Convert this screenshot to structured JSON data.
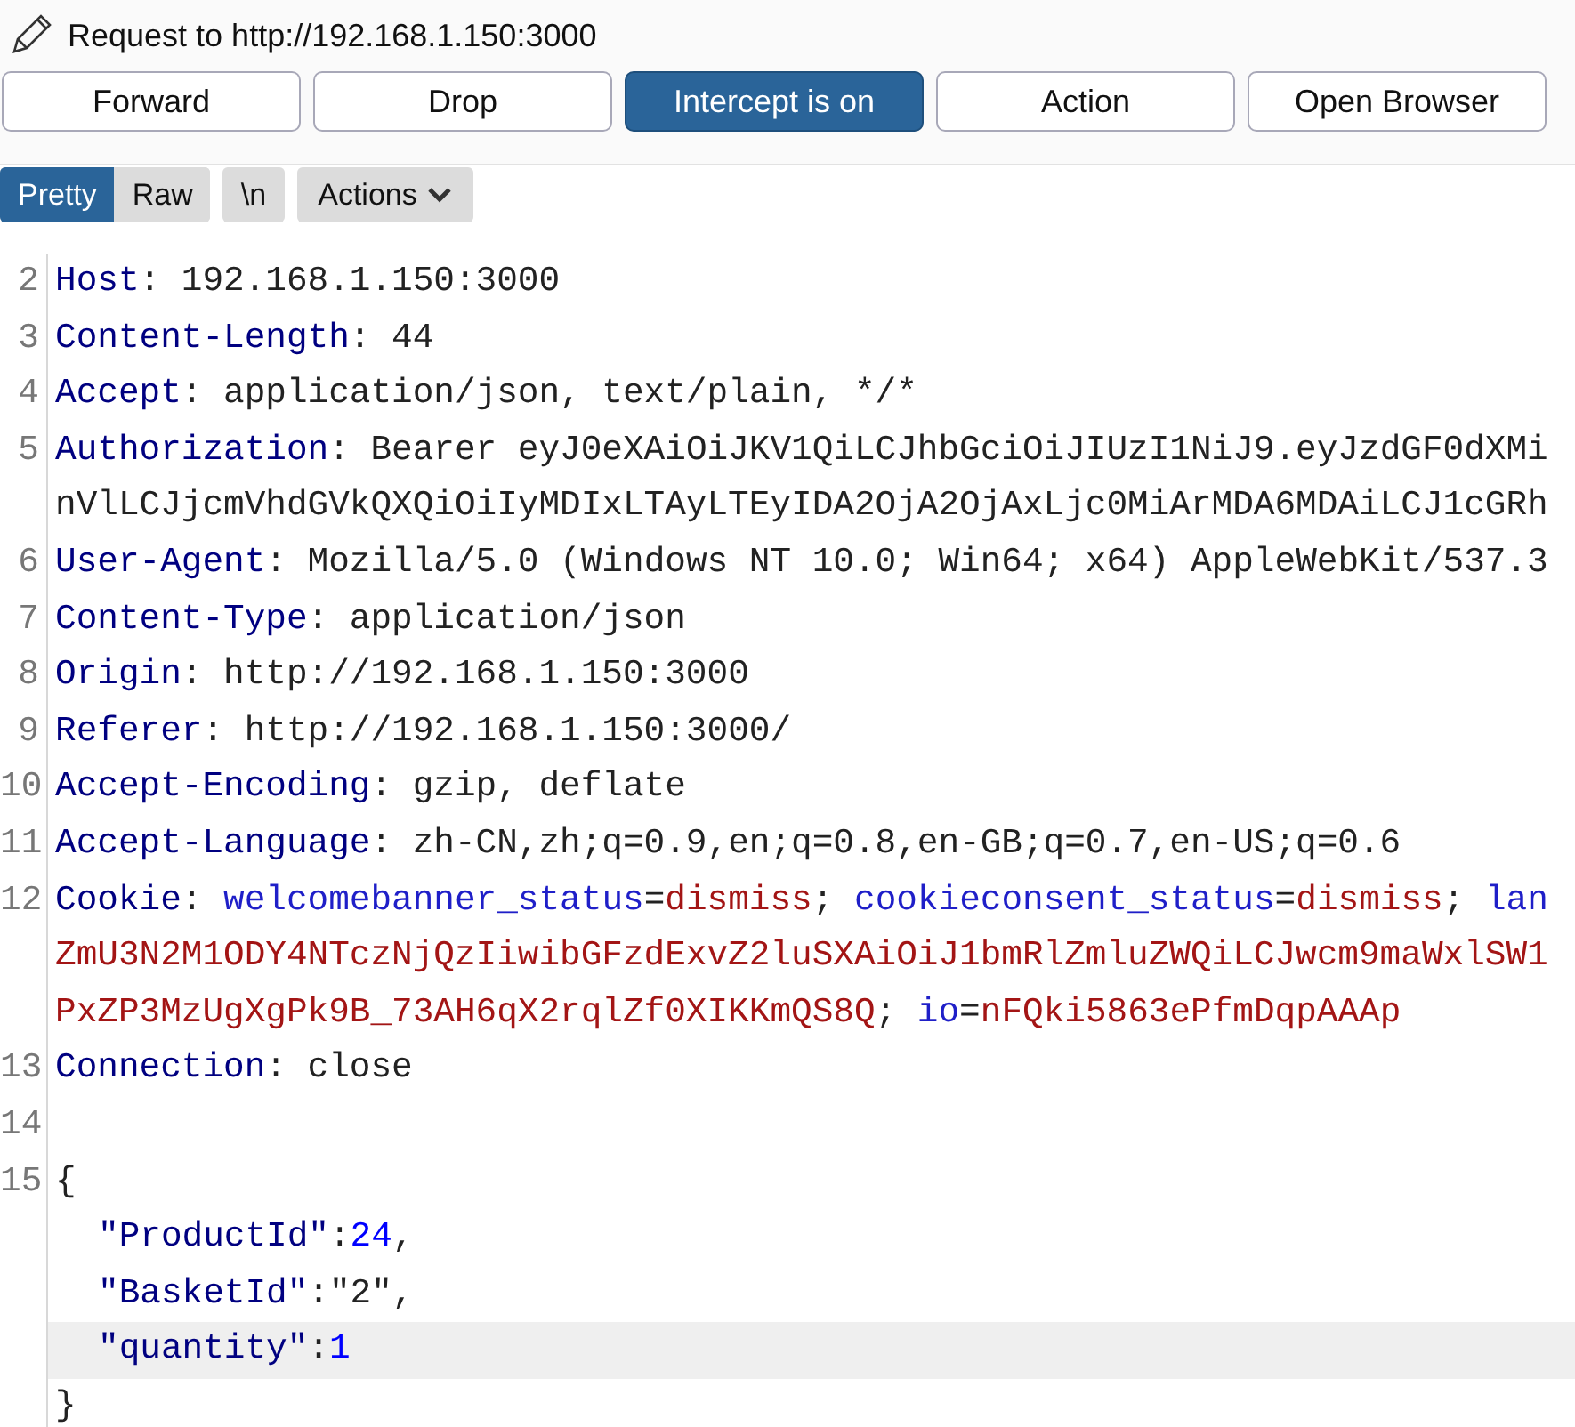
{
  "title": "Request to http://192.168.1.150:3000",
  "buttons": [
    {
      "label": "Forward",
      "selected": false
    },
    {
      "label": "Drop",
      "selected": false
    },
    {
      "label": "Intercept is on",
      "selected": true
    },
    {
      "label": "Action",
      "selected": false
    },
    {
      "label": "Open Browser",
      "selected": false
    }
  ],
  "view_tabs": [
    {
      "label": "Pretty",
      "selected": true
    },
    {
      "label": "Raw",
      "selected": false
    }
  ],
  "newline_toggle": {
    "label": "\\n"
  },
  "actions_menu": {
    "label": "Actions"
  },
  "editor": {
    "lines": [
      {
        "number": "2",
        "rows": [
          {
            "highlighted": false,
            "segments": [
              {
                "kind": "key",
                "text": "Host"
              },
              {
                "kind": "plain",
                "text": ": 192.168.1.150:3000"
              }
            ]
          }
        ]
      },
      {
        "number": "3",
        "rows": [
          {
            "highlighted": false,
            "segments": [
              {
                "kind": "key",
                "text": "Content-Length"
              },
              {
                "kind": "plain",
                "text": ": 44"
              }
            ]
          }
        ]
      },
      {
        "number": "4",
        "rows": [
          {
            "highlighted": false,
            "segments": [
              {
                "kind": "key",
                "text": "Accept"
              },
              {
                "kind": "plain",
                "text": ": application/json, text/plain, */*"
              }
            ]
          }
        ]
      },
      {
        "number": "5",
        "rows": [
          {
            "highlighted": false,
            "segments": [
              {
                "kind": "key",
                "text": "Authorization"
              },
              {
                "kind": "plain",
                "text": ": Bearer eyJ0eXAiOiJKV1QiLCJhbGciOiJIUzI1NiJ9.eyJzdGF0dXMi"
              }
            ]
          },
          {
            "highlighted": false,
            "segments": [
              {
                "kind": "plain",
                "text": "nVlLCJjcmVhdGVkQXQiOiIyMDIxLTAyLTEyIDA2OjA2OjAxLjc0MiArMDA6MDAiLCJ1cGRh"
              }
            ]
          }
        ]
      },
      {
        "number": "6",
        "rows": [
          {
            "highlighted": false,
            "segments": [
              {
                "kind": "key",
                "text": "User-Agent"
              },
              {
                "kind": "plain",
                "text": ": Mozilla/5.0 (Windows NT 10.0; Win64; x64) AppleWebKit/537.3"
              }
            ]
          }
        ]
      },
      {
        "number": "7",
        "rows": [
          {
            "highlighted": false,
            "segments": [
              {
                "kind": "key",
                "text": "Content-Type"
              },
              {
                "kind": "plain",
                "text": ": application/json"
              }
            ]
          }
        ]
      },
      {
        "number": "8",
        "rows": [
          {
            "highlighted": false,
            "segments": [
              {
                "kind": "key",
                "text": "Origin"
              },
              {
                "kind": "plain",
                "text": ": http://192.168.1.150:3000"
              }
            ]
          }
        ]
      },
      {
        "number": "9",
        "rows": [
          {
            "highlighted": false,
            "segments": [
              {
                "kind": "key",
                "text": "Referer"
              },
              {
                "kind": "plain",
                "text": ": http://192.168.1.150:3000/"
              }
            ]
          }
        ]
      },
      {
        "number": "10",
        "rows": [
          {
            "highlighted": false,
            "segments": [
              {
                "kind": "key",
                "text": "Accept-Encoding"
              },
              {
                "kind": "plain",
                "text": ": gzip, deflate"
              }
            ]
          }
        ]
      },
      {
        "number": "11",
        "rows": [
          {
            "highlighted": false,
            "segments": [
              {
                "kind": "key",
                "text": "Accept-Language"
              },
              {
                "kind": "plain",
                "text": ": zh-CN,zh;q=0.9,en;q=0.8,en-GB;q=0.7,en-US;q=0.6"
              }
            ]
          }
        ]
      },
      {
        "number": "12",
        "rows": [
          {
            "highlighted": false,
            "segments": [
              {
                "kind": "key",
                "text": "Cookie"
              },
              {
                "kind": "plain",
                "text": ": "
              },
              {
                "kind": "cookie_name",
                "text": "welcomebanner_status"
              },
              {
                "kind": "plain",
                "text": "="
              },
              {
                "kind": "cookie_value",
                "text": "dismiss"
              },
              {
                "kind": "plain",
                "text": "; "
              },
              {
                "kind": "cookie_name",
                "text": "cookieconsent_status"
              },
              {
                "kind": "plain",
                "text": "="
              },
              {
                "kind": "cookie_value",
                "text": "dismiss"
              },
              {
                "kind": "plain",
                "text": "; "
              },
              {
                "kind": "cookie_name",
                "text": "lan"
              }
            ]
          },
          {
            "highlighted": false,
            "segments": [
              {
                "kind": "cookie_value",
                "text": "ZmU3N2M1ODY4NTczNjQzIiwibGFzdExvZ2luSXAiOiJ1bmRlZmluZWQiLCJwcm9maWxlSW1"
              }
            ]
          },
          {
            "highlighted": false,
            "segments": [
              {
                "kind": "cookie_value",
                "text": "PxZP3MzUgXgPk9B_73AH6qX2rqlZf0XIKKmQS8Q"
              },
              {
                "kind": "plain",
                "text": "; "
              },
              {
                "kind": "cookie_name",
                "text": "io"
              },
              {
                "kind": "plain",
                "text": "="
              },
              {
                "kind": "cookie_value",
                "text": "nFQki5863ePfmDqpAAAp"
              }
            ]
          }
        ]
      },
      {
        "number": "13",
        "rows": [
          {
            "highlighted": false,
            "segments": [
              {
                "kind": "key",
                "text": "Connection"
              },
              {
                "kind": "plain",
                "text": ": close"
              }
            ]
          }
        ]
      },
      {
        "number": "14",
        "rows": [
          {
            "highlighted": false,
            "segments": []
          }
        ]
      },
      {
        "number": "15",
        "rows": [
          {
            "highlighted": false,
            "segments": [
              {
                "kind": "plain",
                "text": "{"
              }
            ]
          },
          {
            "highlighted": false,
            "indented": true,
            "segments": [
              {
                "kind": "key",
                "text": "\"ProductId\""
              },
              {
                "kind": "plain",
                "text": ":"
              },
              {
                "kind": "number",
                "text": "24"
              },
              {
                "kind": "plain",
                "text": ","
              }
            ]
          },
          {
            "highlighted": false,
            "indented": true,
            "segments": [
              {
                "kind": "key",
                "text": "\"BasketId\""
              },
              {
                "kind": "plain",
                "text": ":\"2\","
              }
            ]
          },
          {
            "highlighted": true,
            "indented": true,
            "segments": [
              {
                "kind": "key",
                "text": "\"quantity\""
              },
              {
                "kind": "plain",
                "text": ":"
              },
              {
                "kind": "number",
                "text": "1"
              }
            ]
          },
          {
            "highlighted": false,
            "segments": [
              {
                "kind": "plain",
                "text": "}"
              }
            ]
          }
        ]
      }
    ]
  }
}
